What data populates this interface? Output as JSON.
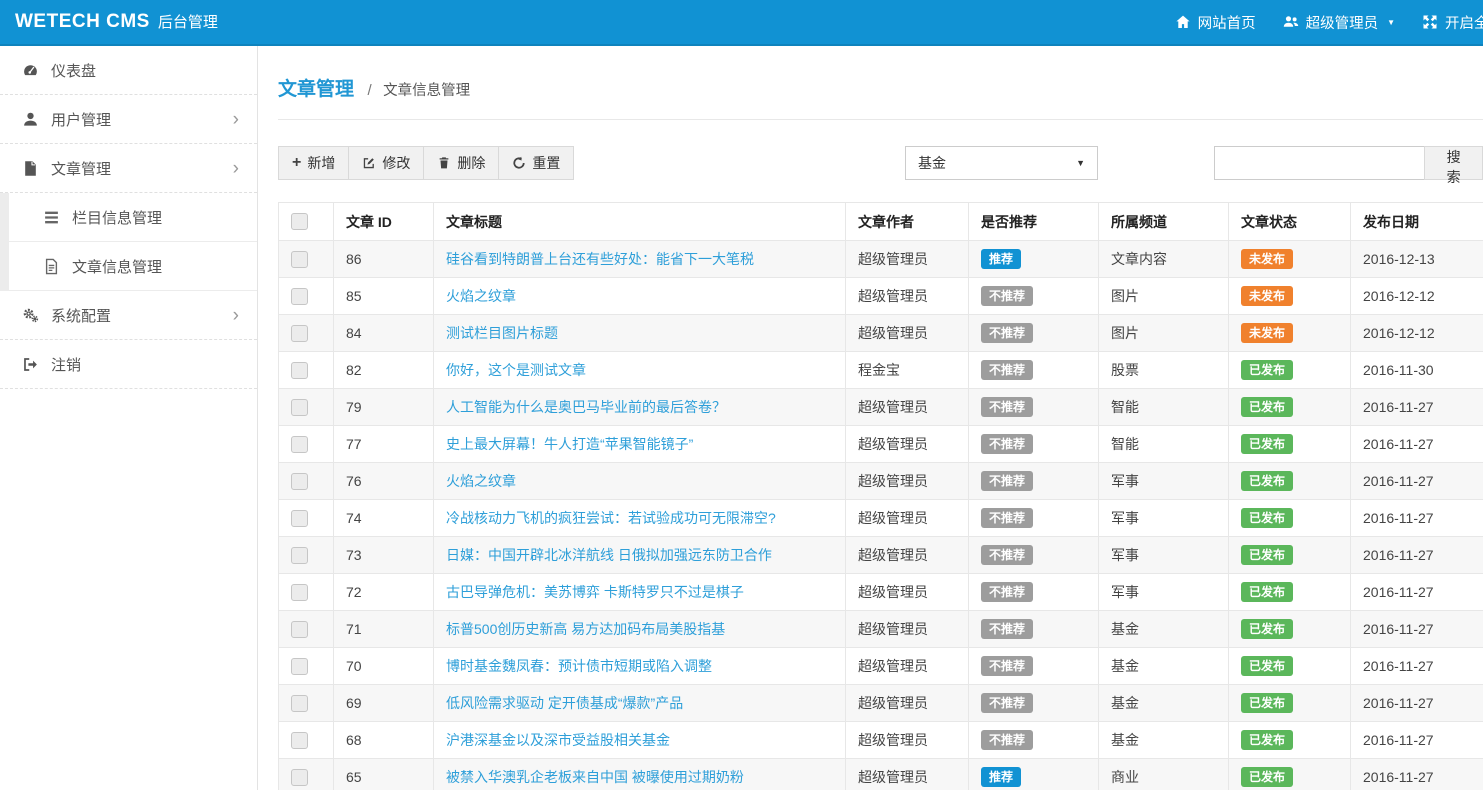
{
  "colors": {
    "primary": "#1192d3",
    "success": "#5bb75b",
    "warning": "#f0812d",
    "muted_badge": "#9d9d9d",
    "link": "#2e9fd9"
  },
  "header": {
    "brand": "WETECH CMS",
    "brand_suffix": "后台管理",
    "nav": [
      {
        "label": "网站首页",
        "icon": "home-icon"
      },
      {
        "label": "超级管理员",
        "icon": "users-icon"
      },
      {
        "label": "开启全屏",
        "icon": "fullscreen-icon"
      }
    ]
  },
  "sidebar": {
    "items": [
      {
        "label": "仪表盘",
        "icon": "dashboard-icon"
      },
      {
        "label": "用户管理",
        "icon": "user-icon",
        "has_submenu": true
      },
      {
        "label": "文章管理",
        "icon": "article-icon",
        "has_submenu": true
      },
      {
        "label": "栏目信息管理",
        "icon": "list-icon",
        "submenu_of": "文章管理"
      },
      {
        "label": "文章信息管理",
        "icon": "file-text-icon",
        "submenu_of": "文章管理"
      },
      {
        "label": "系统配置",
        "icon": "gears-icon",
        "has_submenu": true
      },
      {
        "label": "注销",
        "icon": "logout-icon"
      }
    ]
  },
  "breadcrumb": {
    "section": "文章管理",
    "separator": "/",
    "page": "文章信息管理"
  },
  "toolbar": {
    "add_label": "新增",
    "edit_label": "修改",
    "delete_label": "删除",
    "reset_label": "重置",
    "channel_filter_value": "基金",
    "search_value": "",
    "search_button_label": "搜索"
  },
  "table": {
    "columns": [
      "文章 ID",
      "文章标题",
      "文章作者",
      "是否推荐",
      "所属频道",
      "文章状态",
      "发布日期"
    ],
    "rows": [
      {
        "id": "86",
        "title": "硅谷看到特朗普上台还有些好处：能省下一大笔税",
        "author": "超级管理员",
        "recommend": "推荐",
        "recommend_type": "primary",
        "channel": "文章内容",
        "status": "未发布",
        "status_type": "warning",
        "date": "2016-12-13"
      },
      {
        "id": "85",
        "title": "火焰之纹章",
        "author": "超级管理员",
        "recommend": "不推荐",
        "recommend_type": "default",
        "channel": "图片",
        "status": "未发布",
        "status_type": "warning",
        "date": "2016-12-12"
      },
      {
        "id": "84",
        "title": "测试栏目图片标题",
        "author": "超级管理员",
        "recommend": "不推荐",
        "recommend_type": "default",
        "channel": "图片",
        "status": "未发布",
        "status_type": "warning",
        "date": "2016-12-12"
      },
      {
        "id": "82",
        "title": "你好，这个是测试文章",
        "author": "程金宝",
        "recommend": "不推荐",
        "recommend_type": "default",
        "channel": "股票",
        "status": "已发布",
        "status_type": "success",
        "date": "2016-11-30"
      },
      {
        "id": "79",
        "title": "人工智能为什么是奥巴马毕业前的最后答卷？",
        "author": "超级管理员",
        "recommend": "不推荐",
        "recommend_type": "default",
        "channel": "智能",
        "status": "已发布",
        "status_type": "success",
        "date": "2016-11-27"
      },
      {
        "id": "77",
        "title": "史上最大屏幕！牛人打造“苹果智能镜子”",
        "author": "超级管理员",
        "recommend": "不推荐",
        "recommend_type": "default",
        "channel": "智能",
        "status": "已发布",
        "status_type": "success",
        "date": "2016-11-27"
      },
      {
        "id": "76",
        "title": "火焰之纹章",
        "author": "超级管理员",
        "recommend": "不推荐",
        "recommend_type": "default",
        "channel": "军事",
        "status": "已发布",
        "status_type": "success",
        "date": "2016-11-27"
      },
      {
        "id": "74",
        "title": "冷战核动力飞机的疯狂尝试：若试验成功可无限滞空?",
        "author": "超级管理员",
        "recommend": "不推荐",
        "recommend_type": "default",
        "channel": "军事",
        "status": "已发布",
        "status_type": "success",
        "date": "2016-11-27"
      },
      {
        "id": "73",
        "title": "日媒：中国开辟北冰洋航线 日俄拟加强远东防卫合作",
        "author": "超级管理员",
        "recommend": "不推荐",
        "recommend_type": "default",
        "channel": "军事",
        "status": "已发布",
        "status_type": "success",
        "date": "2016-11-27"
      },
      {
        "id": "72",
        "title": "古巴导弹危机：美苏博弈 卡斯特罗只不过是棋子",
        "author": "超级管理员",
        "recommend": "不推荐",
        "recommend_type": "default",
        "channel": "军事",
        "status": "已发布",
        "status_type": "success",
        "date": "2016-11-27"
      },
      {
        "id": "71",
        "title": "标普500创历史新高 易方达加码布局美股指基",
        "author": "超级管理员",
        "recommend": "不推荐",
        "recommend_type": "default",
        "channel": "基金",
        "status": "已发布",
        "status_type": "success",
        "date": "2016-11-27"
      },
      {
        "id": "70",
        "title": "博时基金魏凤春：预计债市短期或陷入调整",
        "author": "超级管理员",
        "recommend": "不推荐",
        "recommend_type": "default",
        "channel": "基金",
        "status": "已发布",
        "status_type": "success",
        "date": "2016-11-27"
      },
      {
        "id": "69",
        "title": "低风险需求驱动 定开债基成“爆款”产品",
        "author": "超级管理员",
        "recommend": "不推荐",
        "recommend_type": "default",
        "channel": "基金",
        "status": "已发布",
        "status_type": "success",
        "date": "2016-11-27"
      },
      {
        "id": "68",
        "title": "沪港深基金以及深市受益股相关基金",
        "author": "超级管理员",
        "recommend": "不推荐",
        "recommend_type": "default",
        "channel": "基金",
        "status": "已发布",
        "status_type": "success",
        "date": "2016-11-27"
      },
      {
        "id": "65",
        "title": "被禁入华澳乳企老板来自中国 被曝使用过期奶粉",
        "author": "超级管理员",
        "recommend": "推荐",
        "recommend_type": "primary",
        "channel": "商业",
        "status": "已发布",
        "status_type": "success",
        "date": "2016-11-27"
      }
    ]
  }
}
